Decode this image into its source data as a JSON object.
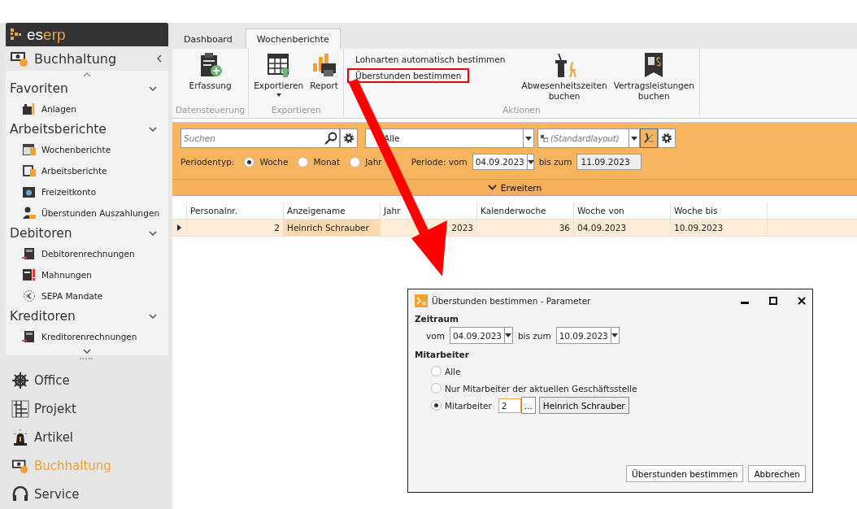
{
  "logo": {
    "prefix": "es",
    "suffix": "erp"
  },
  "sidebar": {
    "module": "Buchhaltung",
    "groups": [
      {
        "title": "Favoriten",
        "items": [
          {
            "label": "Anlagen"
          }
        ]
      },
      {
        "title": "Arbeitsberichte",
        "items": [
          {
            "label": "Wochenberichte"
          },
          {
            "label": "Arbeitsberichte"
          },
          {
            "label": "Freizeitkonto"
          },
          {
            "label": "Überstunden Auszahlungen"
          }
        ]
      },
      {
        "title": "Debitoren",
        "items": [
          {
            "label": "Debitorenrechnungen"
          },
          {
            "label": "Mahnungen"
          },
          {
            "label": "SEPA Mandate"
          }
        ]
      },
      {
        "title": "Kreditoren",
        "items": [
          {
            "label": "Kreditorenrechnungen"
          }
        ]
      }
    ],
    "modules": [
      {
        "label": "Office",
        "selected": false
      },
      {
        "label": "Projekt",
        "selected": false
      },
      {
        "label": "Artikel",
        "selected": false
      },
      {
        "label": "Buchhaltung",
        "selected": true
      },
      {
        "label": "Service",
        "selected": false
      }
    ]
  },
  "tabs": [
    {
      "label": "Dashboard",
      "selected": false
    },
    {
      "label": "Wochenberichte",
      "selected": true
    }
  ],
  "ribbon": {
    "groups": [
      {
        "title": "Datensteuerung",
        "items": [
          {
            "kind": "large",
            "label": "Erfassung"
          }
        ]
      },
      {
        "title": "Exportieren",
        "items": [
          {
            "kind": "large",
            "label": "Exportieren",
            "dropdown": true
          },
          {
            "kind": "large",
            "label": "Report"
          }
        ]
      },
      {
        "title": "Aktionen",
        "items": [
          {
            "kind": "small",
            "label": "Lohnarten automatisch bestimmen",
            "highlighted": false
          },
          {
            "kind": "small",
            "label": "Überstunden bestimmen",
            "highlighted": true
          },
          {
            "kind": "large",
            "label": "Abwesenheitszeiten buchen"
          },
          {
            "kind": "large",
            "label": "Vertragsleistungen buchen"
          }
        ]
      }
    ]
  },
  "filter": {
    "search": {
      "placeholder": "Suchen"
    },
    "selection": "Alle",
    "layout": {
      "placeholder": "(Standardlayout)"
    },
    "period_type_label": "Periodentyp:",
    "period_types": [
      {
        "label": "Woche",
        "selected": true
      },
      {
        "label": "Monat",
        "selected": false
      },
      {
        "label": "Jahr",
        "selected": false
      }
    ],
    "period_label": "Periode: vom",
    "period_from": "04.09.2023",
    "period_to_label": "bis zum",
    "period_to": "11.09.2023",
    "expand": "Erweitern"
  },
  "table": {
    "columns": [
      {
        "label": "Personalnr.",
        "kind": "number"
      },
      {
        "label": "Anzeigename",
        "kind": "text"
      },
      {
        "label": "Jahr",
        "kind": "number"
      },
      {
        "label": "Kalenderwoche",
        "kind": "number"
      },
      {
        "label": "Woche von",
        "kind": "text"
      },
      {
        "label": "Woche bis",
        "kind": "text"
      }
    ],
    "rows": [
      {
        "selected": true,
        "cells": [
          "2",
          "Heinrich Schrauber",
          "2023",
          "36",
          "04.09.2023",
          "10.09.2023"
        ]
      }
    ]
  },
  "dialog": {
    "title": "Überstunden bestimmen - Parameter",
    "period_heading": "Zeitraum",
    "from_label": "vom",
    "from": "04.09.2023",
    "to_label": "bis zum",
    "to": "10.09.2023",
    "employee_heading": "Mitarbeiter",
    "options": [
      {
        "kind": "plain",
        "label": "Alle",
        "selected": false
      },
      {
        "kind": "plain",
        "label": "Nur Mitarbeiter der aktuellen Geschäftsstelle",
        "selected": false
      },
      {
        "kind": "employee",
        "label": "Mitarbeiter",
        "selected": true,
        "number": "2",
        "browse": "...",
        "name": "Heinrich Schrauber"
      }
    ],
    "buttons": [
      "Überstunden bestimmen",
      "Abbrechen"
    ]
  }
}
